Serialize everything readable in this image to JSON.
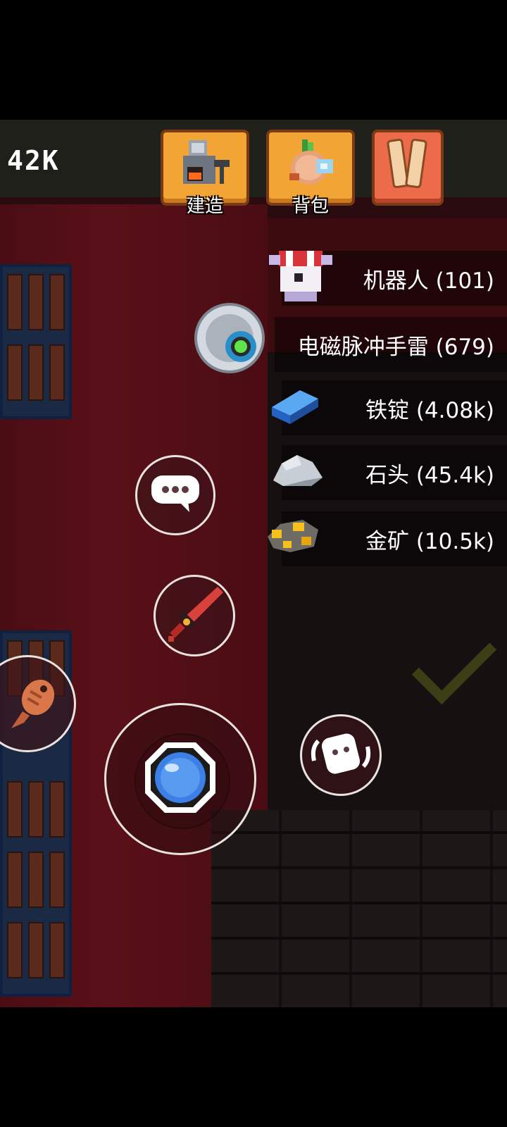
{
  "hud": {
    "score": "42K"
  },
  "top_buttons": [
    {
      "id": "build",
      "label": "建造",
      "icon": "forge-icon"
    },
    {
      "id": "bag",
      "label": "背包",
      "icon": "backpack-icon"
    },
    {
      "id": "scroll",
      "label": "",
      "icon": "scroll-icon"
    }
  ],
  "resources": [
    {
      "name": "机器人",
      "count": "101",
      "text": "机器人 (101)",
      "icon": "robot-icon"
    },
    {
      "name": "电磁脉冲手雷",
      "count": "679",
      "text": "电磁脉冲手雷 (679)",
      "icon": "emp-grenade-icon"
    },
    {
      "name": "铁锭",
      "count": "4.08k",
      "text": "铁锭 (4.08k)",
      "icon": "iron-ingot-icon"
    },
    {
      "name": "石头",
      "count": "45.4k",
      "text": "石头 (45.4k)",
      "icon": "stone-icon"
    },
    {
      "name": "金矿",
      "count": "10.5k",
      "text": "金矿 (10.5k)",
      "icon": "gold-ore-icon"
    }
  ],
  "actions": [
    {
      "id": "chat",
      "icon": "chat-bubble-icon"
    },
    {
      "id": "weapon",
      "icon": "sword-icon"
    },
    {
      "id": "food",
      "icon": "fish-icon"
    },
    {
      "id": "skill",
      "icon": "blue-orb-icon"
    },
    {
      "id": "swap",
      "icon": "rotate-swap-icon"
    }
  ],
  "colors": {
    "button_orange": "#f2a534",
    "button_red": "#ec6b4b",
    "floor_red": "#4a0d14"
  }
}
